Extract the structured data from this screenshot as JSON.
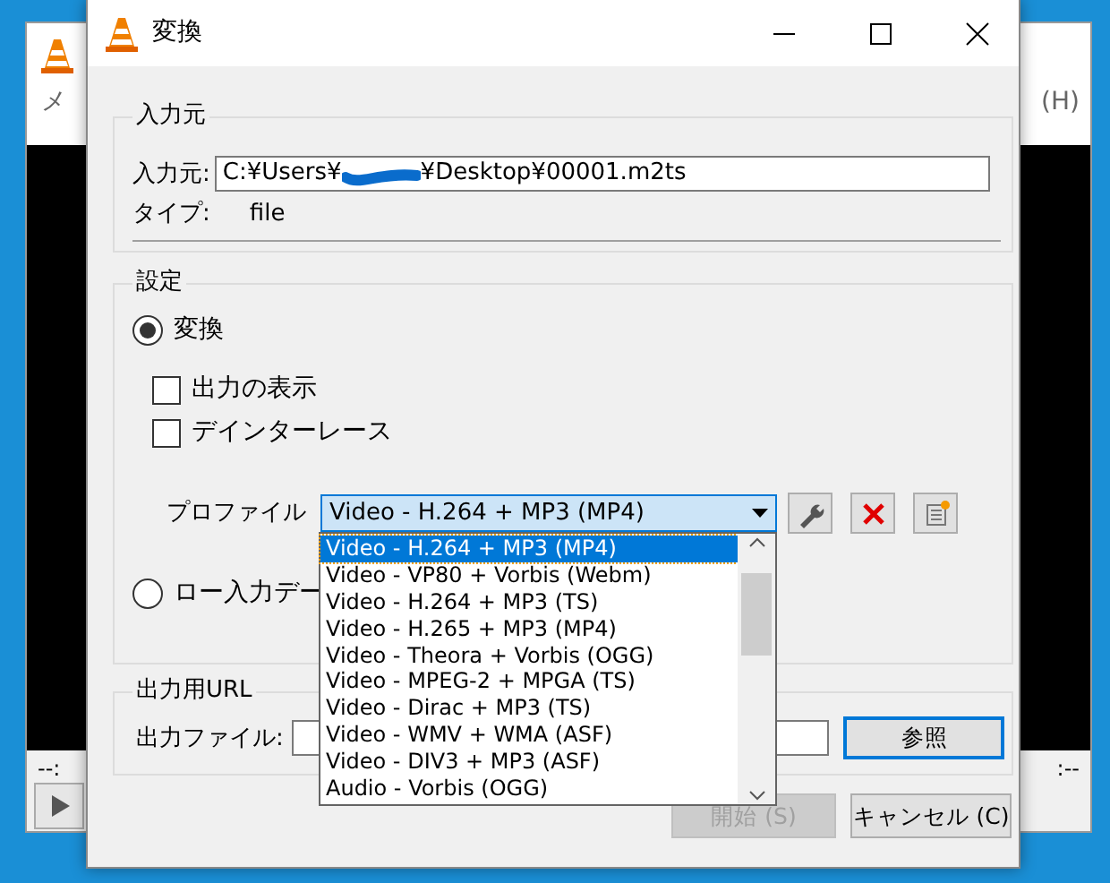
{
  "background_window": {
    "menu_left": "メ",
    "menu_right": "(H)",
    "time_left": "--:",
    "time_right": ":--"
  },
  "window": {
    "title": "変換"
  },
  "source": {
    "title": "入力元",
    "input_label": "入力元:",
    "value_before": "C:¥Users¥",
    "redacted": true,
    "value_after": "¥Desktop¥00001.m2ts",
    "type_label": "タイプ:",
    "type_value": "file"
  },
  "settings": {
    "title": "設定",
    "modes": [
      {
        "label": "変換",
        "selected": true
      },
      {
        "label": "ロー入力デー",
        "selected": false
      }
    ],
    "options": [
      {
        "label": "出力の表示",
        "checked": false
      },
      {
        "label": "デインターレース",
        "checked": false
      }
    ],
    "profile_label": "プロファイル",
    "profile_value": "Video - H.264 + MP3 (MP4)",
    "profile_list": [
      {
        "label": "Video - H.264 + MP3 (MP4)",
        "selected": true
      },
      {
        "label": "Video - VP80 + Vorbis (Webm)",
        "selected": false
      },
      {
        "label": "Video - H.264 + MP3 (TS)",
        "selected": false
      },
      {
        "label": "Video - H.265 + MP3 (MP4)",
        "selected": false
      },
      {
        "label": "Video - Theora + Vorbis (OGG)",
        "selected": false
      },
      {
        "label": "Video - MPEG-2 + MPGA (TS)",
        "selected": false
      },
      {
        "label": "Video - Dirac + MP3 (TS)",
        "selected": false
      },
      {
        "label": "Video - WMV + WMA (ASF)",
        "selected": false
      },
      {
        "label": "Video - DIV3 + MP3 (ASF)",
        "selected": false
      },
      {
        "label": "Audio - Vorbis (OGG)",
        "selected": false
      }
    ]
  },
  "output": {
    "title": "出力用URL",
    "file_label": "出力ファイル:",
    "browse": "参照"
  },
  "buttons": [
    {
      "label": "開始 (S)",
      "disabled": true
    },
    {
      "label": "キャンセル (C)",
      "disabled": false
    }
  ]
}
